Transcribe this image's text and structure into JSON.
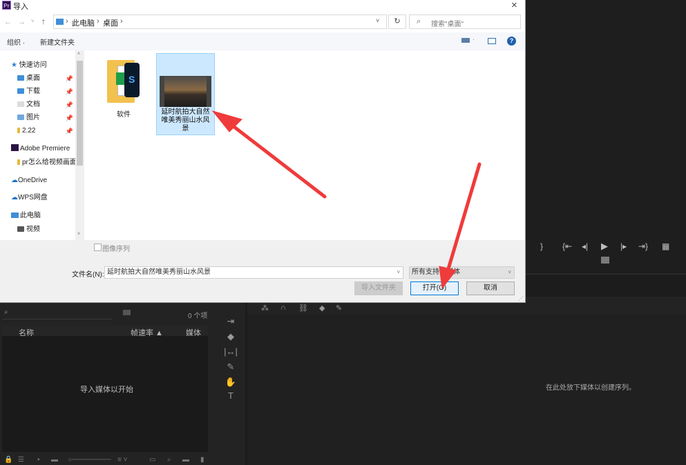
{
  "dialog": {
    "title": "导入",
    "app_icon_text": "Pr",
    "close_glyph": "×",
    "breadcrumb": [
      "此电脑",
      "桌面"
    ],
    "search_placeholder": "搜索\"桌面\"",
    "toolbar": {
      "organize": "组织 ·",
      "new_folder": "新建文件夹"
    },
    "nav": [
      {
        "label": "快速访问"
      },
      {
        "label": "桌面",
        "pin": "📌"
      },
      {
        "label": "下载",
        "pin": "📌"
      },
      {
        "label": "文档",
        "pin": "📌"
      },
      {
        "label": "图片",
        "pin": "📌"
      },
      {
        "label": "2.22",
        "pin": "📌"
      },
      {
        "label": "Adobe Premiere"
      },
      {
        "label": "pr怎么给视频画面"
      },
      {
        "label": "OneDrive"
      },
      {
        "label": "WPS网盘"
      },
      {
        "label": "此电脑"
      },
      {
        "label": "视频"
      }
    ],
    "files": [
      {
        "name": "软件",
        "type": "folder"
      },
      {
        "name": "延时航拍大自然唯美秀丽山水风景",
        "type": "video",
        "selected": true
      }
    ],
    "image_sequence_label": "图像序列",
    "filename_label": "文件名(N):",
    "filename_value": "延时航拍大自然唯美秀丽山水风景",
    "filetype_value": "所有支持的媒体",
    "import_folder_btn": "导入文件夹",
    "open_btn": "打开(O)",
    "cancel_btn": "取消"
  },
  "premiere": {
    "project_items_count": "0 个项",
    "columns": [
      "名称",
      "帧速率 ▲",
      "媒体开"
    ],
    "empty_project_text": "导入媒体以开始",
    "timeline_empty_text": "在此处放下媒体以创建序列。"
  },
  "colors": {
    "selection": "#cce8ff",
    "annotation_arrow": "#ef3b3b",
    "accent": "#0078d7"
  }
}
